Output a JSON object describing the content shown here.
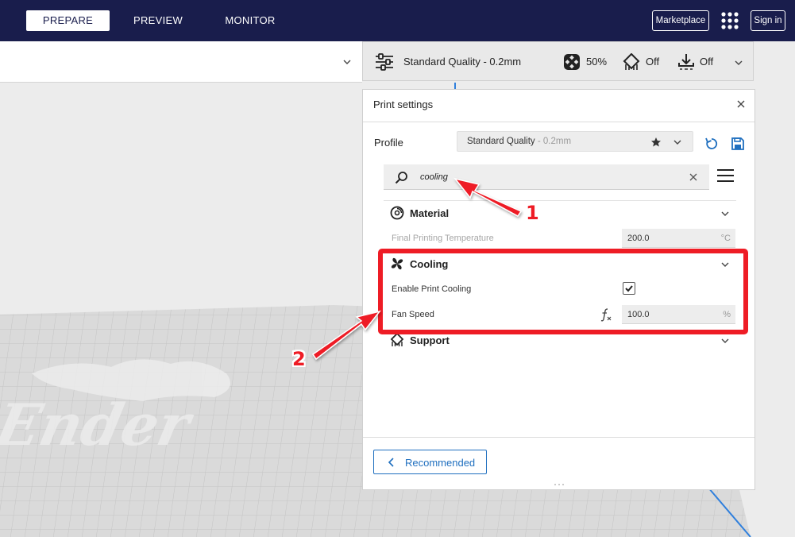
{
  "stages": {
    "prepare": "PREPARE",
    "preview": "PREVIEW",
    "monitor": "MONITOR"
  },
  "topbar": {
    "marketplace": "Marketplace",
    "signin": "Sign in",
    "apps_icon": "grid-icon"
  },
  "print_setup": {
    "quality": "Standard Quality - 0.2mm",
    "infill": "50%",
    "support": "Off",
    "adhesion": "Off"
  },
  "print_settings": {
    "title": "Print settings",
    "profile_label": "Profile",
    "profile_name": "Standard Quality",
    "profile_sub": " - 0.2mm",
    "search_value": "cooling",
    "categories": {
      "material": "Material",
      "cooling": "Cooling",
      "support": "Support"
    },
    "settings": {
      "final_temp": {
        "label": "Final Printing Temperature",
        "value": "200.0",
        "unit": "°C"
      },
      "enable_cooling": {
        "label": "Enable Print Cooling",
        "checked": true
      },
      "fan_speed": {
        "label": "Fan Speed",
        "value": "100.0",
        "unit": "%"
      }
    },
    "recommended_label": "Recommended"
  },
  "viewport": {
    "bed_logo_text": "Ender"
  },
  "annotations": {
    "callout_1": "1",
    "callout_2": "2",
    "highlight_color": "#ee1c25"
  },
  "colors": {
    "topbar_bg": "#191d4c",
    "accent_blue": "#1f6fbf",
    "bed_blue": "#2f7fdc"
  }
}
